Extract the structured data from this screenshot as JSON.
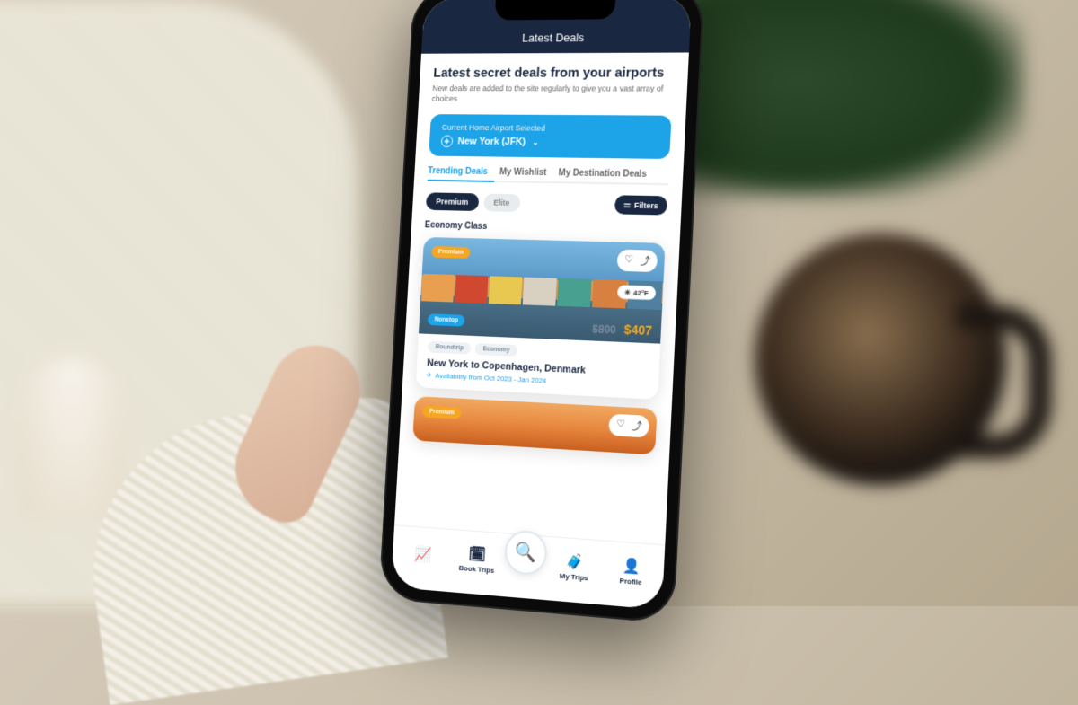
{
  "header": {
    "title": "Latest Deals"
  },
  "page": {
    "heading": "Latest secret deals from your airports",
    "subheading": "New deals are added to the site regularly to give you a vast array of choices"
  },
  "airport": {
    "label": "Current Home Airport Selected",
    "value": "New York (JFK)"
  },
  "tabs": [
    {
      "label": "Trending Deals",
      "active": true
    },
    {
      "label": "My Wishlist",
      "active": false
    },
    {
      "label": "My Destination Deals",
      "active": false
    }
  ],
  "chips": {
    "premium": "Premium",
    "elite": "Elite",
    "filters": "Filters"
  },
  "section": {
    "label": "Economy Class"
  },
  "deal": {
    "badge_premium": "Premium",
    "badge_nonstop": "Nonstop",
    "temperature": "42°F",
    "price_old": "$800",
    "price_new": "$407",
    "pill_roundtrip": "Roundtrip",
    "pill_economy": "Economy",
    "title": "New York to Copenhagen, Denmark",
    "availability": "Availability from Oct 2023 - Jan 2024"
  },
  "deal2": {
    "badge_premium": "Premium"
  },
  "nav": {
    "deals": "",
    "book": "Book Trips",
    "trips": "My Trips",
    "profile": "Profile"
  }
}
